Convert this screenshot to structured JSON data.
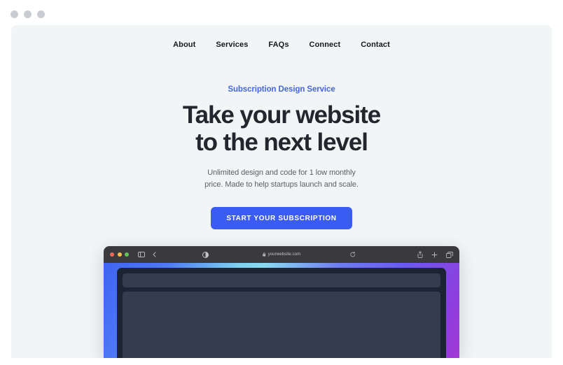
{
  "window": {
    "dots": [
      "window-dot-1",
      "window-dot-2",
      "window-dot-3"
    ],
    "dot_color": "#c9cdd1",
    "card_background": "#f1f5f6"
  },
  "nav": {
    "items": [
      {
        "label": "About"
      },
      {
        "label": "Services"
      },
      {
        "label": "FAQs"
      },
      {
        "label": "Connect"
      },
      {
        "label": "Contact"
      }
    ]
  },
  "hero": {
    "eyebrow": "Subscription Design Service",
    "eyebrow_color": "#4565e0",
    "title_line1": "Take your website",
    "title_line2": "to the next level",
    "title_color": "#23262c",
    "subtitle_line1": "Unlimited design and code for 1 low monthly",
    "subtitle_line2": "price. Made to help startups launch and scale.",
    "cta_label": "START YOUR SUBSCRIPTION",
    "cta_color": "#3b5cf4"
  },
  "mockup": {
    "toolbar": {
      "traffic_lights": [
        "#ec6a5e",
        "#f4bf4f",
        "#61c454"
      ],
      "sidebar_icon": "sidebar-toggle-icon",
      "back_icon": "chevron-left-icon",
      "reader_icon": "reader-contrast-icon",
      "lock_icon": "lock-icon",
      "url": "yourwebsite.com",
      "reload_icon": "reload-icon",
      "share_icon": "share-icon",
      "new_tab_icon": "plus-icon",
      "tabs_icon": "tab-overview-icon"
    },
    "viewport": {
      "gradient_start": "#3f63f2",
      "gradient_mid": "#8adbf1",
      "gradient_end": "#a23ad6",
      "frame_color": "#1b2433",
      "panel_color": "#333d4f"
    }
  }
}
